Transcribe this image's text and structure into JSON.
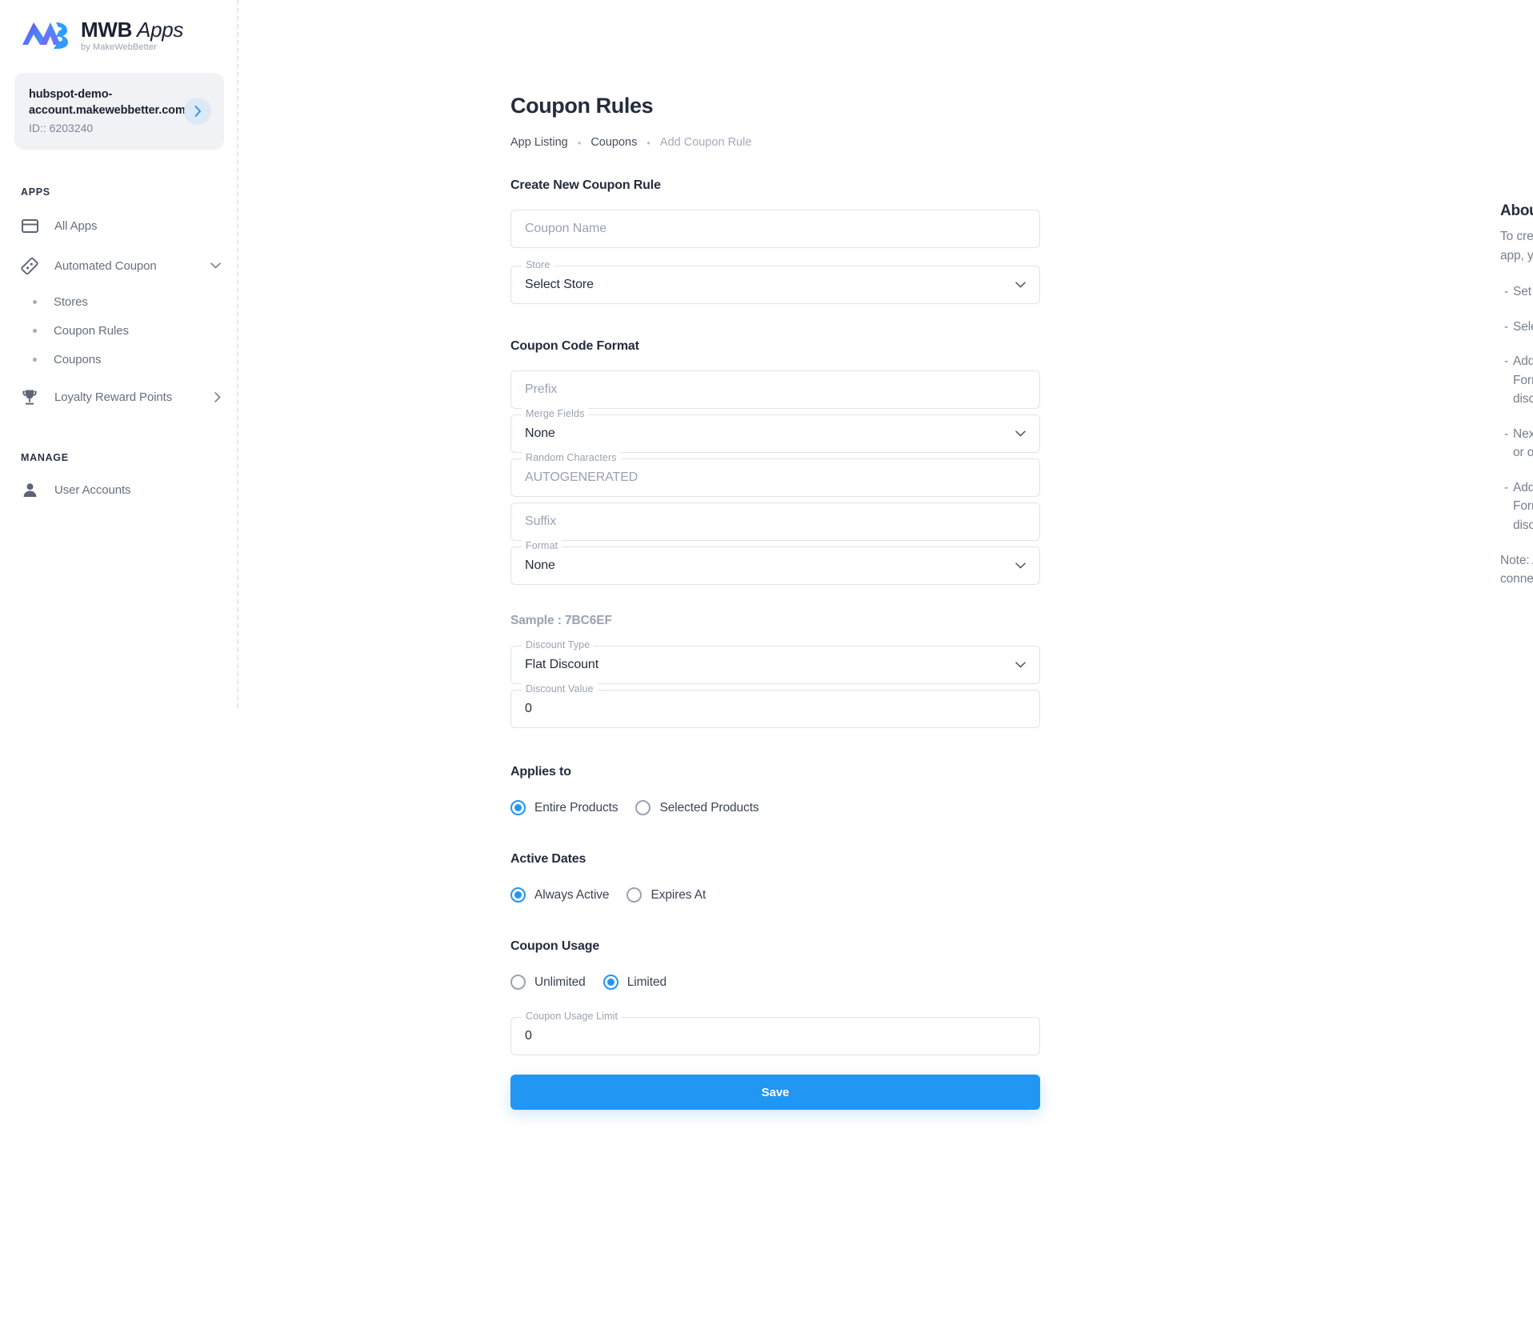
{
  "brand": {
    "title_bold": "MWB",
    "title_italic": "Apps",
    "subtitle": "by MakeWebBetter"
  },
  "account": {
    "domain": "hubspot-demo-account.makewebbetter.com",
    "id": "ID:: 6203240"
  },
  "sidebar": {
    "apps_label": "APPS",
    "manage_label": "MANAGE",
    "items": [
      {
        "label": "All Apps",
        "icon": "card-icon"
      },
      {
        "label": "Automated Coupon",
        "icon": "coupon-icon"
      },
      {
        "label": "Loyalty Reward Points",
        "icon": "trophy-icon"
      }
    ],
    "sub_items": [
      {
        "label": "Stores"
      },
      {
        "label": "Coupon Rules"
      },
      {
        "label": "Coupons"
      }
    ],
    "manage_items": [
      {
        "label": "User Accounts",
        "icon": "user-icon"
      }
    ]
  },
  "topbar": {
    "language_icon": "uk-flag-icon",
    "avatar_icon": "user-avatar-icon"
  },
  "header": {
    "title": "Coupon Rules",
    "breadcrumb": [
      {
        "label": "App Listing",
        "current": false
      },
      {
        "label": "Coupons",
        "current": false
      },
      {
        "label": "Add Coupon Rule",
        "current": true
      }
    ],
    "separator": "•"
  },
  "form": {
    "create_heading": "Create New Coupon Rule",
    "coupon_name": {
      "placeholder": "Coupon Name",
      "value": ""
    },
    "store": {
      "label": "Store",
      "value": "Select Store"
    },
    "format_heading": "Coupon Code Format",
    "prefix": {
      "placeholder": "Prefix",
      "value": ""
    },
    "merge_fields": {
      "label": "Merge Fields",
      "value": "None"
    },
    "random_characters": {
      "label": "Random Characters",
      "placeholder": "AUTOGENERATED",
      "value": ""
    },
    "suffix": {
      "placeholder": "Suffix",
      "value": ""
    },
    "format": {
      "label": "Format",
      "value": "None"
    },
    "sample": "Sample : 7BC6EF",
    "discount_type": {
      "label": "Discount Type",
      "value": "Flat Discount"
    },
    "discount_value": {
      "label": "Discount Value",
      "value": "0"
    },
    "applies_to": {
      "heading": "Applies to",
      "options": [
        {
          "label": "Entire Products",
          "selected": true
        },
        {
          "label": "Selected Products",
          "selected": false
        }
      ]
    },
    "active_dates": {
      "heading": "Active Dates",
      "options": [
        {
          "label": "Always Active",
          "selected": true
        },
        {
          "label": "Expires At",
          "selected": false
        }
      ]
    },
    "coupon_usage": {
      "heading": "Coupon Usage",
      "options": [
        {
          "label": "Unlimited",
          "selected": false
        },
        {
          "label": "Limited",
          "selected": true
        }
      ]
    },
    "usage_limit": {
      "label": "Coupon Usage Limit",
      "value": "0"
    },
    "save_label": "Save"
  },
  "info": {
    "title": "About Discount Coupon",
    "intro": "To create or generate coupon codes for your eCommerce store with the Automated Coupons app, you must consider a certain set of rules for easy managing and monitoring purposes.",
    "bullets": [
      "Set a unique name for each coupon rule",
      "Select the targeted eCommerce store to list and give away coupons",
      "Add coupon rules to define the format of the coupon code generated. Under the Coupon Code Format, set the values for the fields like prefix, merge field, auto-generated characters, suffix, discount type, coupon value, etc.",
      "Next, add other rules like coupon expiry date, whether coupons are applicable on all products or only on selected products, coupon usage limit, etc. under the section Applies to.",
      "Add coupon rules to define the format of the coupon code generated. Under the Coupon Code Format, set the values for the fields like prefix, merge field, auto-generated characters, suffix, discount type, coupon value, etc."
    ],
    "note": "Note: All the generated coupons will be listed within the app (Coupons section) and also in your connected eCommerce store."
  },
  "colors": {
    "accent": "#2196f3",
    "text_dark": "#242c3d",
    "text_muted": "#767f8e",
    "border": "#dfe3e9"
  }
}
